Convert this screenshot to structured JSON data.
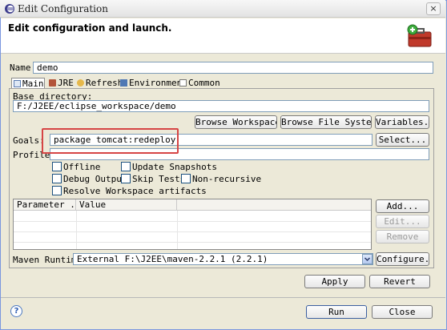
{
  "window": {
    "title": "Edit Configuration",
    "close_label": "×"
  },
  "banner": {
    "title": "Edit configuration and launch."
  },
  "name_row": {
    "label": "Name:",
    "value": "demo"
  },
  "tabs": [
    {
      "label": "Main",
      "icon": "main-tab-icon"
    },
    {
      "label": "JRE",
      "icon": "jre-tab-icon"
    },
    {
      "label": "Refresh",
      "icon": "refresh-tab-icon"
    },
    {
      "label": "Environment",
      "icon": "environment-tab-icon"
    },
    {
      "label": "Common",
      "icon": "common-tab-icon"
    }
  ],
  "main": {
    "base_dir_label": "Base directory:",
    "base_dir_value": "F:/J2EE/eclipse_workspace/demo",
    "browse_workspace": "Browse Workspace...",
    "browse_file_system": "Browse File System...",
    "variables": "Variables...",
    "goals_label": "Goals:",
    "goals_value": "package tomcat:redeploy",
    "select": "Select...",
    "profiles_label": "Profiles:",
    "profiles_value": "",
    "options": {
      "offline": "Offline",
      "update_snapshots": "Update Snapshots",
      "debug_output": "Debug Output",
      "skip_tests": "Skip Tests",
      "non_recursive": "Non-recursive",
      "resolve_workspace": "Resolve Workspace artifacts"
    },
    "table": {
      "col_parameter": "Parameter ...",
      "col_value": "Value"
    },
    "add": "Add...",
    "edit": "Edit...",
    "remove": "Remove",
    "runtime_label": "Maven Runtime:",
    "runtime_value": "External F:\\J2EE\\maven-2.2.1 (2.2.1)",
    "configure": "Configure..."
  },
  "footer": {
    "apply": "Apply",
    "revert": "Revert",
    "run": "Run",
    "close": "Close",
    "help": "?"
  }
}
